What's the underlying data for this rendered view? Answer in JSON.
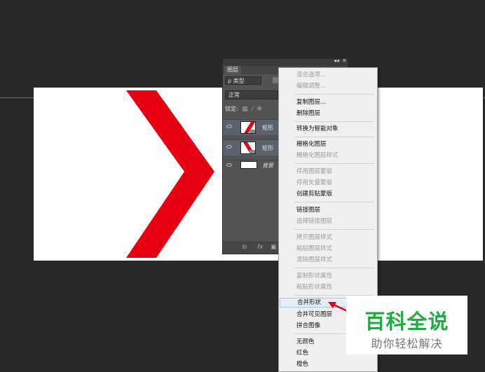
{
  "colors": {
    "workspace": "#282828",
    "canvas": "#ffffff",
    "shape_red": "#e60012",
    "guide": "#3fa6c8",
    "panel": "#535353",
    "menu_bg": "#f0f0f0",
    "menu_highlight": "#e5eef8",
    "watermark_green": "#1aae3c",
    "annotation_arrow": "#e60012"
  },
  "layers_panel": {
    "tab": "图层",
    "collapse_icon": "double-chevron-icon",
    "close_icon": "close-icon",
    "filter": "ρ 类型",
    "blend_mode": "正常",
    "lock_label": "锁定:",
    "layers": [
      {
        "name": "矩形",
        "selected": true,
        "icon": "eye-icon"
      },
      {
        "name": "矩形",
        "selected": true,
        "icon": "eye-icon"
      },
      {
        "name": "背景",
        "selected": false,
        "icon": "eye-icon"
      }
    ],
    "bottom_icons": [
      "link-icon",
      "fx-icon",
      "mask-icon"
    ],
    "link_glyph": "⊖",
    "fx_glyph": "fx"
  },
  "context_menu": {
    "items": [
      {
        "label": "混合选项...",
        "enabled": false
      },
      {
        "label": "编辑调整...",
        "enabled": false
      },
      {
        "label": "复制图层...",
        "enabled": true
      },
      {
        "label": "删除图层",
        "enabled": true
      },
      {
        "label": "转换为智能对象",
        "enabled": true
      },
      {
        "label": "栅格化图层",
        "enabled": true
      },
      {
        "label": "栅格化图层样式",
        "enabled": false
      },
      {
        "label": "停用图层蒙版",
        "enabled": false
      },
      {
        "label": "停用矢量蒙版",
        "enabled": false
      },
      {
        "label": "创建剪贴蒙版",
        "enabled": true
      },
      {
        "label": "链接图层",
        "enabled": true
      },
      {
        "label": "选择链接图层",
        "enabled": false
      },
      {
        "label": "拷贝图层样式",
        "enabled": false
      },
      {
        "label": "粘贴图层样式",
        "enabled": false
      },
      {
        "label": "清除图层样式",
        "enabled": false
      },
      {
        "label": "复制形状属性",
        "enabled": false
      },
      {
        "label": "粘贴形状属性",
        "enabled": false
      },
      {
        "label": "合并形状",
        "enabled": true,
        "highlighted": true
      },
      {
        "label": "合并可见图层",
        "enabled": true
      },
      {
        "label": "拼合图像",
        "enabled": true
      },
      {
        "label": "无颜色",
        "enabled": true
      },
      {
        "label": "红色",
        "enabled": true
      },
      {
        "label": "橙色",
        "enabled": true
      }
    ]
  },
  "watermark": {
    "title": "百科全说",
    "subtitle": "助你轻松解决"
  }
}
